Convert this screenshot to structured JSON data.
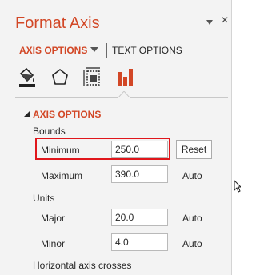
{
  "pane": {
    "title": "Format Axis",
    "close_glyph": "×",
    "icons": {
      "pin": "dropdown-triangle-icon",
      "close": "close-icon"
    }
  },
  "tabs": {
    "axis_options": "AXIS OPTIONS",
    "text_options": "TEXT OPTIONS",
    "active": "axis_options"
  },
  "categories": [
    {
      "name": "fill-line",
      "icon": "paint-bucket-icon"
    },
    {
      "name": "effects",
      "icon": "pentagon-icon"
    },
    {
      "name": "size-properties",
      "icon": "size-properties-icon"
    },
    {
      "name": "axis-options",
      "icon": "bar-chart-icon",
      "active": true
    }
  ],
  "section": {
    "title": "AXIS OPTIONS",
    "expanded": true
  },
  "bounds": {
    "label": "Bounds",
    "minimum_label": "Minimum",
    "minimum_value": "250.0",
    "minimum_action": "Reset",
    "maximum_label": "Maximum",
    "maximum_value": "390.0",
    "maximum_state": "Auto"
  },
  "units": {
    "label": "Units",
    "major_label": "Major",
    "major_value": "20.0",
    "major_state": "Auto",
    "minor_label": "Minor",
    "minor_value": "4.0",
    "minor_state": "Auto"
  },
  "crosses": {
    "label": "Horizontal axis crosses"
  },
  "colors": {
    "accent": "#d24726",
    "highlight": "#e0161b",
    "pane_bg": "#f3f3f3"
  }
}
